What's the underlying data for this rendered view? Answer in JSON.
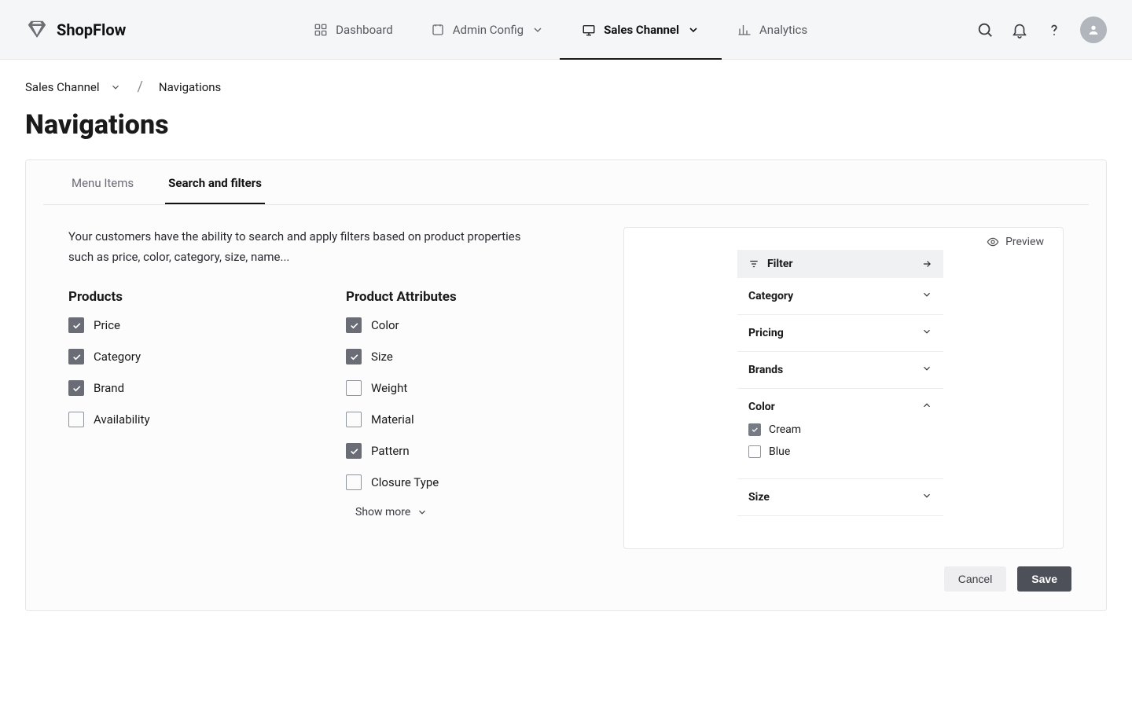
{
  "brand": {
    "name": "ShopFlow"
  },
  "nav": {
    "items": [
      {
        "label": "Dashboard"
      },
      {
        "label": "Admin Config"
      },
      {
        "label": "Sales Channel"
      },
      {
        "label": "Analytics"
      }
    ]
  },
  "breadcrumb": {
    "root": "Sales Channel",
    "current": "Navigations"
  },
  "page": {
    "title": "Navigations"
  },
  "tabs": {
    "menu_items": "Menu Items",
    "search_filters": "Search and filters"
  },
  "panel": {
    "description": "Your customers have the ability to search and apply filters based on product properties such as price, color, category, size,  name...",
    "products": {
      "heading": "Products",
      "items": [
        {
          "label": "Price",
          "checked": true
        },
        {
          "label": "Category",
          "checked": true
        },
        {
          "label": "Brand",
          "checked": true
        },
        {
          "label": "Availability",
          "checked": false
        }
      ]
    },
    "attributes": {
      "heading": "Product Attributes",
      "items": [
        {
          "label": "Color",
          "checked": true
        },
        {
          "label": "Size",
          "checked": true
        },
        {
          "label": "Weight",
          "checked": false
        },
        {
          "label": "Material",
          "checked": false
        },
        {
          "label": "Pattern",
          "checked": true
        },
        {
          "label": "Closure Type",
          "checked": false
        }
      ],
      "show_more": "Show more"
    }
  },
  "preview": {
    "label": "Preview",
    "filter_heading": "Filter",
    "sections": [
      {
        "label": "Category",
        "expanded": false
      },
      {
        "label": "Pricing",
        "expanded": false
      },
      {
        "label": "Brands",
        "expanded": false
      },
      {
        "label": "Color",
        "expanded": true,
        "options": [
          {
            "label": "Cream",
            "checked": true
          },
          {
            "label": "Blue",
            "checked": false
          }
        ]
      },
      {
        "label": "Size",
        "expanded": false
      }
    ]
  },
  "actions": {
    "cancel": "Cancel",
    "save": "Save"
  }
}
